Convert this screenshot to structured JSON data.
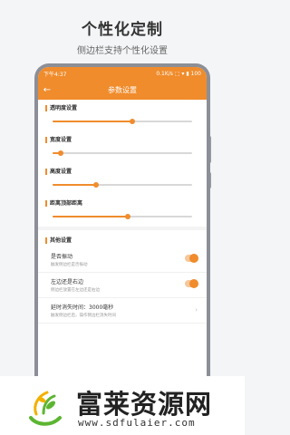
{
  "promo": {
    "title": "个性化定制",
    "subtitle": "侧边栏支持个性化设置"
  },
  "statusbar": {
    "time": "下午4:37",
    "right": "0.1K/s ⬚ ▾ ▮ 100"
  },
  "appbar": {
    "back_icon": "back-arrow-icon",
    "title": "参数设置"
  },
  "sliders": [
    {
      "label": "透明度设置",
      "value": 0.57
    },
    {
      "label": "宽度设置",
      "value": 0.06
    },
    {
      "label": "高度设置",
      "value": 0.31
    },
    {
      "label": "距离顶部距离",
      "value": 0.54
    }
  ],
  "other": {
    "header": "其他设置",
    "items": [
      {
        "title": "是否振动",
        "desc": "触发侧边栏是否振动",
        "type": "toggle",
        "on": true
      },
      {
        "title": "左边还是右边",
        "desc": "侧边栏放置在左边还是右边",
        "type": "toggle",
        "on": true
      },
      {
        "title": "延时消失时间：3000毫秒",
        "desc": "触发侧边栏后，操作侧边栏消失时间",
        "type": "link"
      }
    ]
  },
  "brand": {
    "name": "富莱资源网",
    "url": "www.sdfulaier.com"
  },
  "colors": {
    "accent": "#f08c2c",
    "logo_green": "#5cb531",
    "logo_yellow": "#f2b000"
  }
}
